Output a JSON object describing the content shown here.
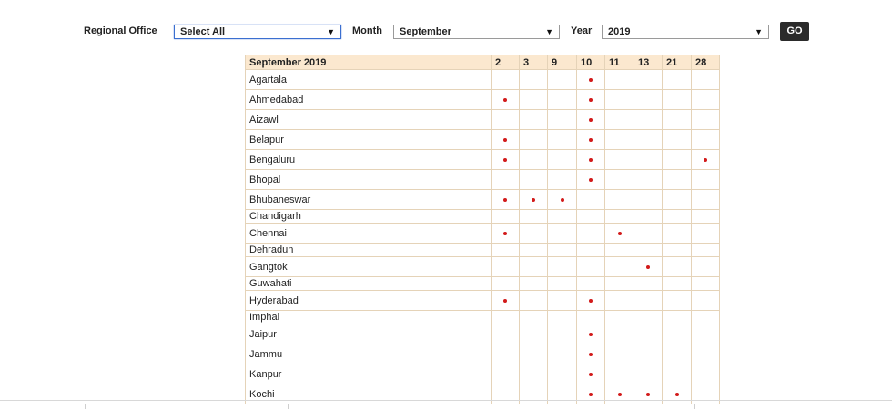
{
  "filters": {
    "regional_office_label": "Regional Office",
    "regional_office_value": "Select All",
    "month_label": "Month",
    "month_value": "September",
    "year_label": "Year",
    "year_value": "2019",
    "go_label": "GO"
  },
  "table": {
    "header": "September 2019",
    "days": [
      "2",
      "3",
      "9",
      "10",
      "11",
      "13",
      "21",
      "28"
    ],
    "dot_color": "#d21a1a",
    "rows": [
      {
        "name": "Agartala",
        "marks": [
          "10"
        ]
      },
      {
        "name": "Ahmedabad",
        "marks": [
          "2",
          "10"
        ]
      },
      {
        "name": "Aizawl",
        "marks": [
          "10"
        ]
      },
      {
        "name": "Belapur",
        "marks": [
          "2",
          "10"
        ]
      },
      {
        "name": "Bengaluru",
        "marks": [
          "2",
          "10",
          "28"
        ]
      },
      {
        "name": "Bhopal",
        "marks": [
          "10"
        ]
      },
      {
        "name": "Bhubaneswar",
        "marks": [
          "2",
          "3",
          "9"
        ]
      },
      {
        "name": "Chandigarh",
        "marks": []
      },
      {
        "name": "Chennai",
        "marks": [
          "2",
          "11"
        ]
      },
      {
        "name": "Dehradun",
        "marks": []
      },
      {
        "name": "Gangtok",
        "marks": [
          "13"
        ]
      },
      {
        "name": "Guwahati",
        "marks": []
      },
      {
        "name": "Hyderabad",
        "marks": [
          "2",
          "10"
        ]
      },
      {
        "name": "Imphal",
        "marks": []
      },
      {
        "name": "Jaipur",
        "marks": [
          "10"
        ]
      },
      {
        "name": "Jammu",
        "marks": [
          "10"
        ]
      },
      {
        "name": "Kanpur",
        "marks": [
          "10"
        ]
      },
      {
        "name": "Kochi",
        "marks": [
          "10",
          "11",
          "13",
          "21"
        ]
      }
    ]
  }
}
